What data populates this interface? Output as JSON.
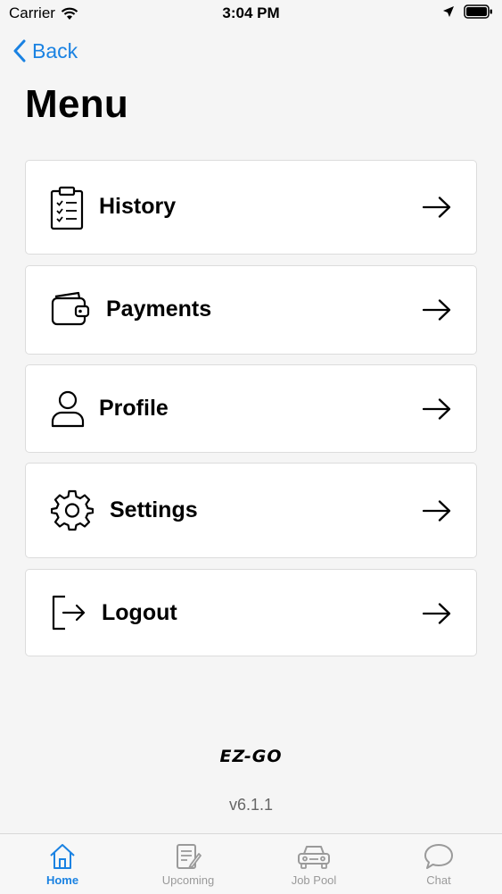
{
  "status_bar": {
    "carrier": "Carrier",
    "time": "3:04 PM"
  },
  "nav": {
    "back_label": "Back"
  },
  "page": {
    "title": "Menu"
  },
  "menu": {
    "items": [
      {
        "label": "History",
        "icon": "clipboard-checklist-icon"
      },
      {
        "label": "Payments",
        "icon": "wallet-icon"
      },
      {
        "label": "Profile",
        "icon": "person-icon"
      },
      {
        "label": "Settings",
        "icon": "gear-icon"
      },
      {
        "label": "Logout",
        "icon": "logout-icon"
      }
    ]
  },
  "brand": {
    "logo_text": "EZ-GO"
  },
  "footer": {
    "version": "v6.1.1"
  },
  "tab_bar": {
    "active": "Home",
    "tabs": [
      {
        "label": "Home",
        "icon": "home-icon"
      },
      {
        "label": "Upcoming",
        "icon": "notepad-icon"
      },
      {
        "label": "Job Pool",
        "icon": "car-icon"
      },
      {
        "label": "Chat",
        "icon": "chat-bubble-icon"
      }
    ]
  },
  "colors": {
    "accent": "#1a82e2",
    "background": "#f5f5f5",
    "card": "#ffffff",
    "inactive_tab": "#9a9a9a"
  }
}
